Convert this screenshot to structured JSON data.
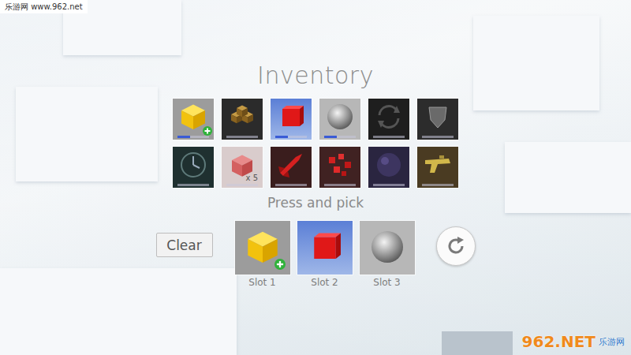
{
  "watermark_top": "乐游网 www.962.net",
  "watermark_bottom": {
    "logo": "962.NET",
    "subtitle": "乐游网"
  },
  "title": "Inventory",
  "items": [
    {
      "kind": "cube",
      "added": true,
      "level": 0.4,
      "count": ""
    },
    {
      "kind": "crates",
      "added": false,
      "level": 0,
      "count": ""
    },
    {
      "kind": "redcube",
      "added": false,
      "level": 0.4,
      "count": ""
    },
    {
      "kind": "sphere",
      "added": false,
      "level": 0.4,
      "count": ""
    },
    {
      "kind": "recycle",
      "added": false,
      "level": 0,
      "count": ""
    },
    {
      "kind": "shield",
      "added": false,
      "level": 0,
      "count": ""
    },
    {
      "kind": "clock",
      "added": false,
      "level": 0,
      "count": ""
    },
    {
      "kind": "pinkcube",
      "added": false,
      "level": 0,
      "count": "x 5"
    },
    {
      "kind": "rocket",
      "added": false,
      "level": 0,
      "count": ""
    },
    {
      "kind": "redcubes",
      "added": false,
      "level": 0,
      "count": ""
    },
    {
      "kind": "darkorb",
      "added": false,
      "level": 0,
      "count": ""
    },
    {
      "kind": "gun",
      "added": false,
      "level": 0,
      "count": ""
    }
  ],
  "hint": "Press and pick",
  "clear_button": "Clear",
  "slots": [
    {
      "label": "Slot 1",
      "kind": "cube",
      "added": true
    },
    {
      "label": "Slot 2",
      "kind": "redcube",
      "added": false
    },
    {
      "label": "Slot 3",
      "kind": "sphere",
      "added": false
    }
  ]
}
